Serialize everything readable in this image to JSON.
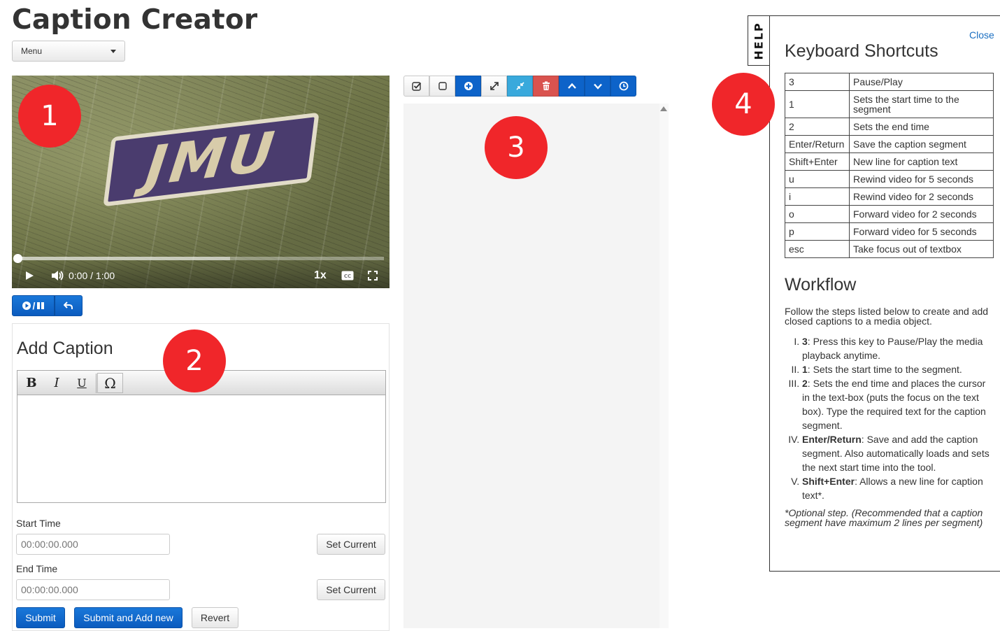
{
  "app": {
    "title": "Caption Creator",
    "menu_label": "Menu"
  },
  "video": {
    "logo_text": "JMU",
    "current_time": "0:00",
    "time_separator": "/",
    "duration": "1:00",
    "speed": "1x",
    "progress_fraction": 0.0,
    "buffered_fraction": 0.58
  },
  "playback_buttons": {
    "play_pause": "/"
  },
  "caption_form": {
    "heading": "Add Caption",
    "toolbar": {
      "bold": "B",
      "italic": "I",
      "underline": "U",
      "special_char": "Ω"
    },
    "start_time_label": "Start Time",
    "start_time_placeholder": "00:00:00.000",
    "end_time_label": "End Time",
    "end_time_placeholder": "00:00:00.000",
    "set_current_label": "Set Current",
    "submit_label": "Submit",
    "submit_add_new_label": "Submit and Add new",
    "revert_label": "Revert"
  },
  "markers": [
    "1",
    "2",
    "3",
    "4"
  ],
  "help": {
    "tab_label": "HELP",
    "close_label": "Close",
    "shortcuts_title": "Keyboard Shortcuts",
    "shortcuts": [
      {
        "key": "3",
        "action": "Pause/Play"
      },
      {
        "key": "1",
        "action": "Sets the start time to the segment"
      },
      {
        "key": "2",
        "action": "Sets the end time"
      },
      {
        "key": "Enter/Return",
        "action": "Save the caption segment"
      },
      {
        "key": "Shift+Enter",
        "action": "New line for caption text"
      },
      {
        "key": "u",
        "action": "Rewind video for 5 seconds"
      },
      {
        "key": "i",
        "action": "Rewind video for 2 seconds"
      },
      {
        "key": "o",
        "action": "Forward video for 2 seconds"
      },
      {
        "key": "p",
        "action": "Forward video for 5 seconds"
      },
      {
        "key": "esc",
        "action": "Take focus out of textbox"
      }
    ],
    "workflow_title": "Workflow",
    "workflow_intro": "Follow the steps listed below to create and add closed captions to a media object.",
    "workflow_steps": [
      {
        "key": "3",
        "text": ": Press this key to Pause/Play the media playback anytime."
      },
      {
        "key": "1",
        "text": ": Sets the start time to the segment."
      },
      {
        "key": "2",
        "text": ": Sets the end time and places the cursor in the text-box (puts the focus on the text box). Type the required text for the caption segment."
      },
      {
        "key": "Enter/Return",
        "text": ": Save and add the caption segment. Also automatically loads and sets the next start time into the tool."
      },
      {
        "key": "Shift+Enter",
        "text": ": Allows a new line for caption text*."
      }
    ],
    "workflow_note": "*Optional step. (Recommended that a caption segment have maximum 2 lines per segment)"
  },
  "colors": {
    "primary_blue": "#0d63c9",
    "cyan": "#39a9dc",
    "danger_red": "#d9534f",
    "marker_red": "#f0262a",
    "link_blue": "#1a6fc2"
  },
  "icons": {
    "segment_toolbar": [
      "check-square-icon",
      "square-icon",
      "plus-circle-icon",
      "expand-icon",
      "compress-icon",
      "trash-icon",
      "chevron-up-icon",
      "chevron-down-icon",
      "clock-icon"
    ]
  }
}
